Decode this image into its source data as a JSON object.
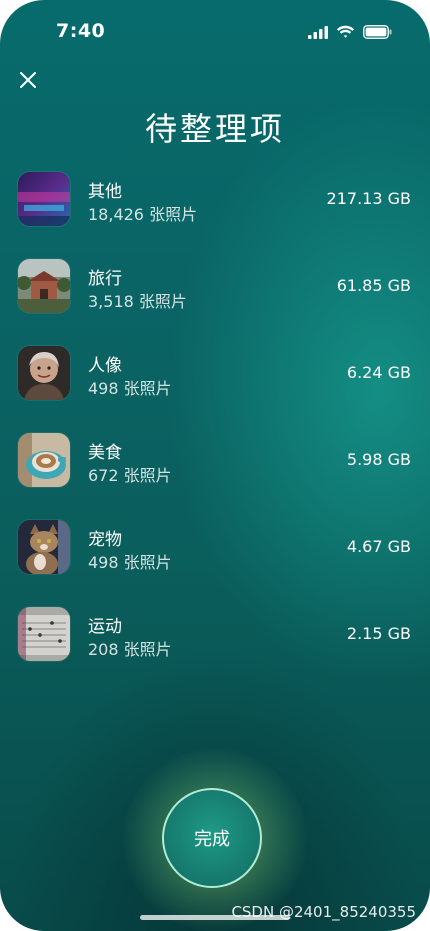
{
  "status_bar": {
    "time": "7:40"
  },
  "page": {
    "title": "待整理项"
  },
  "categories": [
    {
      "name": "其他",
      "count": "18,426 张照片",
      "size": "217.13 GB",
      "thumb": "misc-thumbnail"
    },
    {
      "name": "旅行",
      "count": "3,518 张照片",
      "size": "61.85 GB",
      "thumb": "travel-thumbnail"
    },
    {
      "name": "人像",
      "count": "498 张照片",
      "size": "6.24 GB",
      "thumb": "portrait-thumbnail"
    },
    {
      "name": "美食",
      "count": "672 张照片",
      "size": "5.98 GB",
      "thumb": "food-thumbnail"
    },
    {
      "name": "宠物",
      "count": "498 张照片",
      "size": "4.67 GB",
      "thumb": "pet-thumbnail"
    },
    {
      "name": "运动",
      "count": "208 张照片",
      "size": "2.15 GB",
      "thumb": "sports-thumbnail"
    }
  ],
  "actions": {
    "done_label": "完成"
  },
  "watermark": "CSDN @2401_85240355",
  "colors": {
    "background": "#0a6465",
    "button": "#15786c",
    "text": "#ffffff"
  }
}
